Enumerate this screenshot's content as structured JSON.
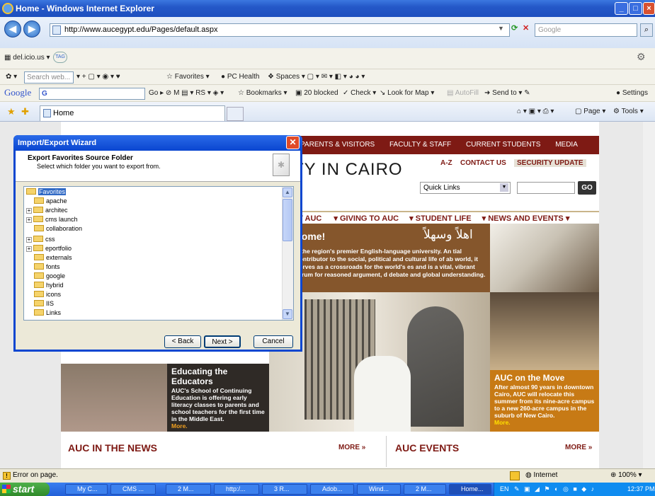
{
  "window": {
    "title": "Home - Windows Internet Explorer"
  },
  "address": {
    "url": "http://www.aucegypt.edu/Pages/default.aspx",
    "search_placeholder": "Google"
  },
  "toolbar1": {
    "delicious": "del.icio.us",
    "tag": "TAG"
  },
  "toolbar2": {
    "search_placeholder": "Search web...",
    "favorites": "Favorites",
    "pc_health": "PC Health",
    "spaces": "Spaces"
  },
  "google_bar": {
    "logo": "Google",
    "g_btn": "G",
    "go": "Go",
    "bookmarks": "Bookmarks",
    "blocked": "20 blocked",
    "check": "Check",
    "lookfor": "Look for Map",
    "autofill": "AutoFill",
    "sendto": "Send to",
    "settings": "Settings"
  },
  "tab": {
    "label": "Home",
    "page_menu": "Page",
    "tools_menu": "Tools"
  },
  "site": {
    "topnav": [
      "PARENTS & VISITORS",
      "FACULTY & STAFF",
      "CURRENT STUDENTS",
      "MEDIA"
    ],
    "title": "TY IN CAIRO",
    "util": [
      "A-Z",
      "CONTACT US",
      "SECURITY UPDATE"
    ],
    "quicklinks": "Quick Links",
    "go": "GO",
    "mainnav": [
      "AT AUC",
      "GIVING TO AUC",
      "STUDENT LIFE",
      "NEWS AND EVENTS"
    ],
    "welcome_title": "come!",
    "welcome_arabic": "اهلاً وسهلاً",
    "welcome_text": "s the region's premier English-language university. An tial contributor to the social, political and cultural life of ab world, it serves as a crossroads for the world's es and is a vital, vibrant forum for reasoned argument, d debate and global understanding.",
    "educators_title": "Educating the Educators",
    "educators_text": "AUC's School of Continuing Education is offering early literacy classes to parents and school teachers for the first time in the Middle East.",
    "educators_more": "More.",
    "move_title": "AUC on the Move",
    "move_text": "After almost 90 years in downtown Cairo, AUC will relocate this summer from its nine-acre campus to a new 260-acre campus in the suburb of New Cairo.",
    "move_more": "More.",
    "news_title": "AUC IN THE NEWS",
    "news_more": "MORE »",
    "events_title": "AUC EVENTS",
    "events_more": "MORE »"
  },
  "dialog": {
    "title": "Import/Export Wizard",
    "heading": "Export Favorites Source Folder",
    "subheading": "Select which folder you want to export from.",
    "tree": [
      {
        "label": "Favorites",
        "expandable": false,
        "selected": true,
        "level": 0
      },
      {
        "label": "apache",
        "expandable": false,
        "level": 1
      },
      {
        "label": "architec",
        "expandable": true,
        "level": 1
      },
      {
        "label": "cms launch",
        "expandable": true,
        "level": 1
      },
      {
        "label": "collaboration",
        "expandable": false,
        "level": 1
      },
      {
        "label": "css",
        "expandable": true,
        "level": 1
      },
      {
        "label": "eportfolio",
        "expandable": true,
        "level": 1
      },
      {
        "label": "externals",
        "expandable": false,
        "level": 1
      },
      {
        "label": "fonts",
        "expandable": false,
        "level": 1
      },
      {
        "label": "google",
        "expandable": false,
        "level": 1
      },
      {
        "label": "hybrid",
        "expandable": false,
        "level": 1
      },
      {
        "label": "icons",
        "expandable": false,
        "level": 1
      },
      {
        "label": "IIS",
        "expandable": false,
        "level": 1
      },
      {
        "label": "Links",
        "expandable": false,
        "level": 1
      }
    ],
    "back": "< Back",
    "next": "Next >",
    "cancel": "Cancel"
  },
  "status": {
    "left": "Error on page.",
    "zone": "Internet",
    "zoom": "100%"
  },
  "taskbar": {
    "start": "start",
    "tasks": [
      "My C...",
      "CMS ...",
      "2 M...",
      "http:/...",
      "3 R...",
      "Adob...",
      "Wind...",
      "2 M...",
      "Home..."
    ],
    "lang": "EN",
    "clock": "12:37 PM"
  },
  "colors": {
    "auc_maroon": "#7e1a14",
    "welcome_brown": "#85562c",
    "move_orange": "#c77a15",
    "xp_blue": "#0a46d0"
  }
}
